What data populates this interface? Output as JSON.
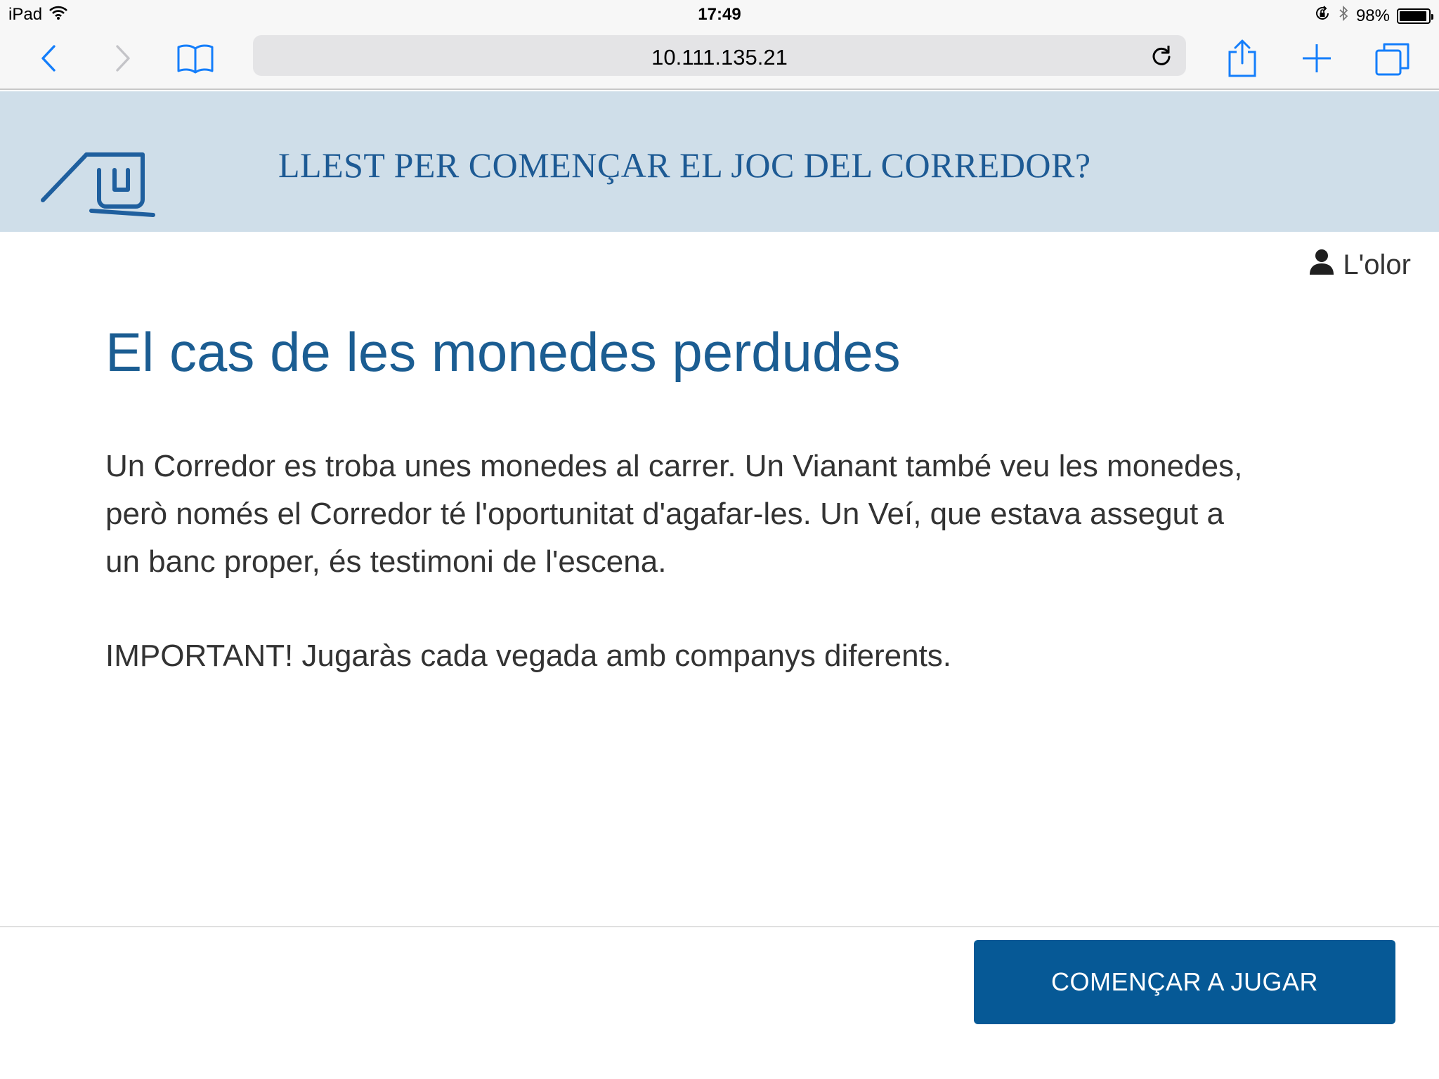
{
  "status_bar": {
    "device": "iPad",
    "time": "17:49",
    "battery": "98%",
    "battery_level": 0.98
  },
  "browser": {
    "url": "10.111.135.21",
    "icons": [
      "back-icon",
      "forward-icon",
      "bookmarks-icon",
      "reload-icon",
      "share-icon",
      "new-tab-icon",
      "tabs-icon"
    ]
  },
  "header": {
    "title": "LLEST PER COMENÇAR EL JOC DEL CORREDOR?"
  },
  "user": {
    "name": "L'olor"
  },
  "main": {
    "title": "El cas de les monedes perdudes",
    "description": "Un Corredor es troba unes monedes al carrer. Un Vianant també veu les monedes, però només el Corredor té l'oportunitat d'agafar-les. Un Veí, que estava assegut a un banc proper, és testimoni de l'escena.",
    "important": "IMPORTANT! Jugaràs cada vegada amb companys diferents."
  },
  "footer": {
    "start_label": "COMENÇAR A JUGAR"
  },
  "colors": {
    "header_bg": "#cfdee9",
    "brand_blue": "#065996",
    "title_blue": "#1b5d92",
    "ios_blue": "#147efb"
  }
}
